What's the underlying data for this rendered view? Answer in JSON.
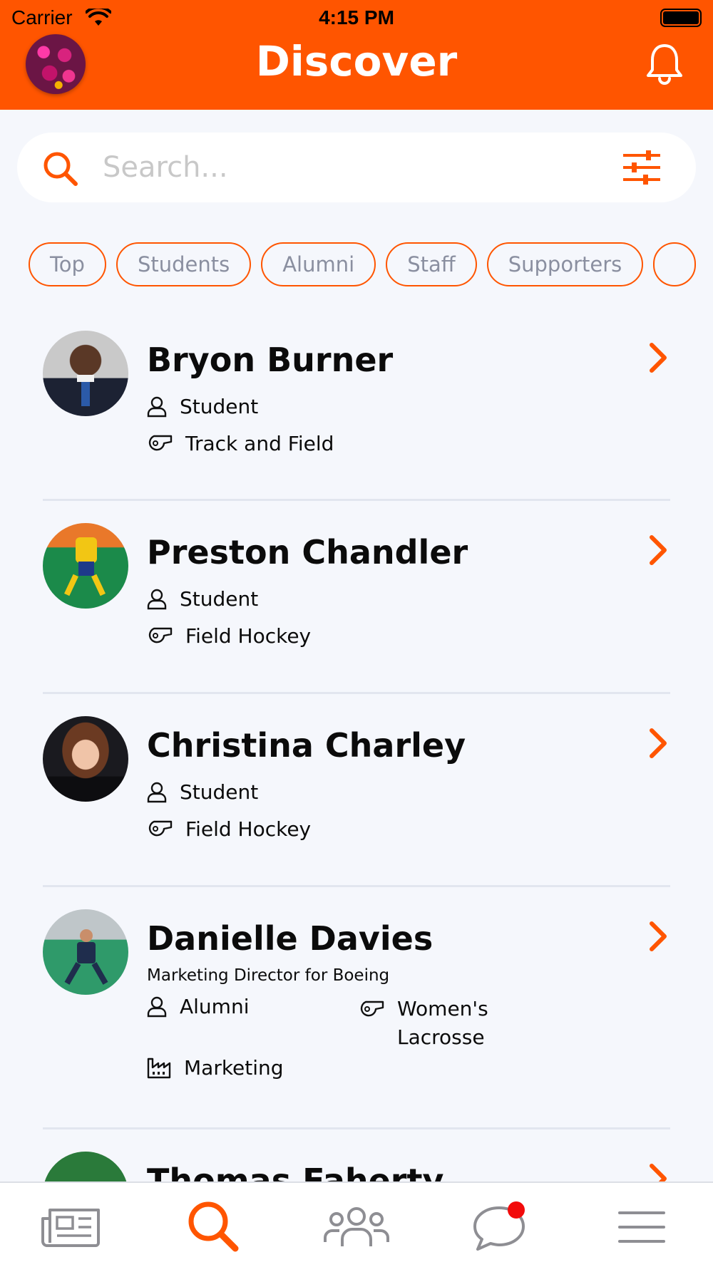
{
  "status_bar": {
    "carrier": "Carrier",
    "time": "4:15 PM"
  },
  "header": {
    "title": "Discover"
  },
  "search": {
    "placeholder": "Search..."
  },
  "filters": [
    "Top",
    "Students",
    "Alumni",
    "Staff",
    "Supporters",
    ""
  ],
  "people": [
    {
      "name": "Bryon Burner",
      "subtitle": "",
      "role": "Student",
      "sport": "Track and Field",
      "industry": ""
    },
    {
      "name": "Preston Chandler",
      "subtitle": "",
      "role": "Student",
      "sport": "Field Hockey",
      "industry": ""
    },
    {
      "name": "Christina Charley",
      "subtitle": "",
      "role": "Student",
      "sport": "Field Hockey",
      "industry": ""
    },
    {
      "name": "Danielle Davies",
      "subtitle": "Marketing Director for Boeing",
      "role": "Alumni",
      "sport": "Women's Lacrosse",
      "industry": "Marketing"
    },
    {
      "name": "Thomas Faherty",
      "subtitle": "",
      "role": "",
      "sport": "",
      "industry": ""
    }
  ],
  "tabs": [
    "news-tab",
    "discover-tab",
    "groups-tab",
    "messages-tab",
    "menu-tab"
  ],
  "colors": {
    "accent": "#ff5500",
    "badge": "#f20b0b",
    "background": "#f5f7fc"
  }
}
